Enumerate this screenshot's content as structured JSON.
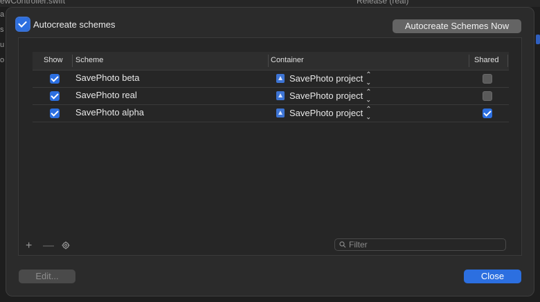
{
  "background": {
    "left_text": "ewController.swift",
    "mid_text": "Release (real)"
  },
  "sheet": {
    "autocreate_checkbox_label": "Autocreate schemes",
    "autocreate_checked": true,
    "autocreate_now_label": "Autocreate Schemes Now",
    "table": {
      "headers": {
        "show": "Show",
        "scheme": "Scheme",
        "container": "Container",
        "shared": "Shared"
      },
      "rows": [
        {
          "show": true,
          "scheme": "SavePhoto beta",
          "container": "SavePhoto project",
          "shared": false
        },
        {
          "show": true,
          "scheme": "SavePhoto real",
          "container": "SavePhoto project",
          "shared": false
        },
        {
          "show": true,
          "scheme": "SavePhoto alpha",
          "container": "SavePhoto project",
          "shared": true
        }
      ]
    },
    "footer": {
      "add_symbol": "+",
      "remove_symbol": "—",
      "filter_placeholder": "Filter"
    },
    "edit_label": "Edit...",
    "close_label": "Close"
  },
  "icons": {
    "add": "plus-icon",
    "remove": "minus-icon",
    "gear": "gear-icon",
    "filter": "search-icon",
    "project": "xcode-project-icon",
    "stepper": "up-down-chevron-icon"
  },
  "colors": {
    "accent": "#2c6fe0",
    "sheet_bg": "#2b2b2b",
    "panel_bg": "#262626"
  }
}
